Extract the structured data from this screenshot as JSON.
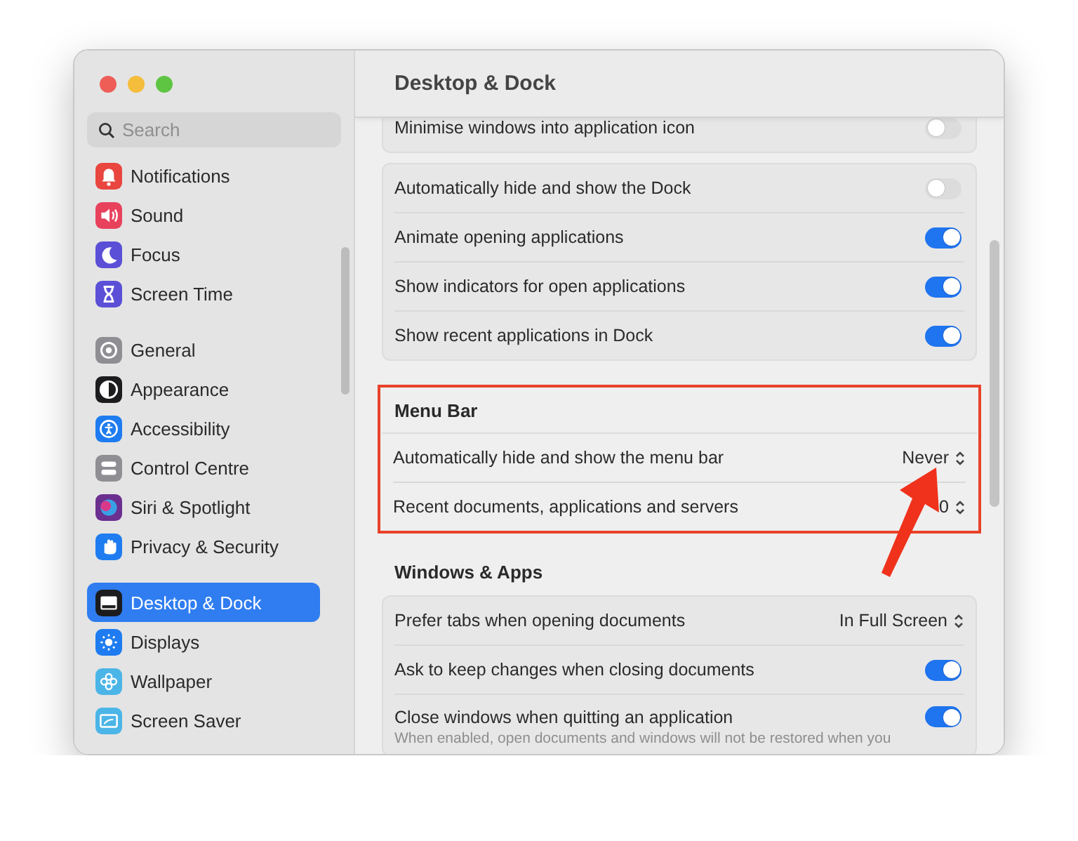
{
  "sidebar": {
    "search": {
      "placeholder": "Search"
    },
    "groups": [
      {
        "items": [
          {
            "label": "Notifications",
            "selected": false
          },
          {
            "label": "Sound",
            "selected": false
          },
          {
            "label": "Focus",
            "selected": false
          },
          {
            "label": "Screen Time",
            "selected": false
          }
        ]
      },
      {
        "items": [
          {
            "label": "General",
            "selected": false
          },
          {
            "label": "Appearance",
            "selected": false
          },
          {
            "label": "Accessibility",
            "selected": false
          },
          {
            "label": "Control Centre",
            "selected": false
          },
          {
            "label": "Siri & Spotlight",
            "selected": false
          },
          {
            "label": "Privacy & Security",
            "selected": false
          }
        ]
      },
      {
        "items": [
          {
            "label": "Desktop & Dock",
            "selected": true
          },
          {
            "label": "Displays",
            "selected": false
          },
          {
            "label": "Wallpaper",
            "selected": false
          },
          {
            "label": "Screen Saver",
            "selected": false
          }
        ]
      }
    ]
  },
  "pane": {
    "title": "Desktop & Dock",
    "sections": [
      {
        "highlighted": false,
        "rows": [
          {
            "kind": "toggle",
            "label": "Minimise windows into application icon",
            "on": false
          }
        ]
      },
      {
        "highlighted": false,
        "rows": [
          {
            "kind": "toggle",
            "label": "Automatically hide and show the Dock",
            "on": false
          },
          {
            "kind": "toggle",
            "label": "Animate opening applications",
            "on": true
          },
          {
            "kind": "toggle",
            "label": "Show indicators for open applications",
            "on": true
          },
          {
            "kind": "toggle",
            "label": "Show recent applications in Dock",
            "on": true
          }
        ]
      },
      {
        "heading": "Menu Bar",
        "highlighted": true,
        "rows": [
          {
            "kind": "select",
            "label": "Automatically hide and show the menu bar",
            "value": "Never"
          },
          {
            "kind": "select",
            "label": "Recent documents, applications and servers",
            "value": "0"
          }
        ]
      },
      {
        "heading": "Windows & Apps",
        "highlighted": false,
        "rows": [
          {
            "kind": "select",
            "label": "Prefer tabs when opening documents",
            "value": "In Full Screen"
          },
          {
            "kind": "toggle",
            "label": "Ask to keep changes when closing documents",
            "on": true
          },
          {
            "kind": "toggle",
            "label": "Close windows when quitting an application",
            "on": true,
            "description": "When enabled, open documents and windows will not be restored when you"
          }
        ]
      }
    ]
  },
  "pointer_arrow": true
}
